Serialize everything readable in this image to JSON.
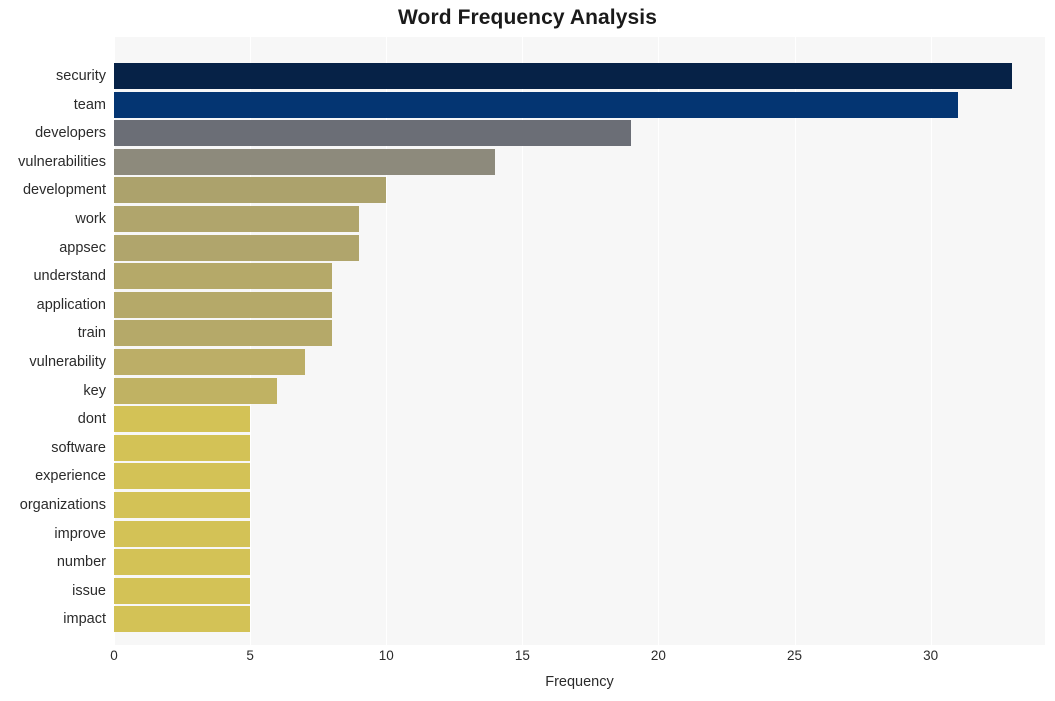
{
  "chart_data": {
    "type": "bar",
    "orientation": "horizontal",
    "title": "Word Frequency Analysis",
    "xlabel": "Frequency",
    "ylabel": "",
    "xlim": [
      0,
      34.2
    ],
    "ylim": null,
    "grid": true,
    "legend": null,
    "xticks": [
      0,
      5,
      10,
      15,
      20,
      25,
      30
    ],
    "xtick_labels": [
      "0",
      "5",
      "10",
      "15",
      "20",
      "25",
      "30"
    ],
    "categories": [
      "security",
      "team",
      "developers",
      "vulnerabilities",
      "development",
      "work",
      "appsec",
      "understand",
      "application",
      "train",
      "vulnerability",
      "key",
      "dont",
      "software",
      "experience",
      "organizations",
      "improve",
      "number",
      "issue",
      "impact"
    ],
    "values": [
      33,
      31,
      19,
      14,
      10,
      9,
      9,
      8,
      8,
      8,
      7,
      6,
      5,
      5,
      5,
      5,
      5,
      5,
      5,
      5
    ],
    "bar_colors": [
      "#062247",
      "#043572",
      "#6b6e76",
      "#8d8a7c",
      "#aca26c",
      "#b0a56c",
      "#b0a56c",
      "#b5a969",
      "#b5a969",
      "#b5a969",
      "#bcae67",
      "#c0b263",
      "#d3c256",
      "#d3c256",
      "#d3c256",
      "#d3c256",
      "#d3c256",
      "#d3c256",
      "#d3c256",
      "#d3c256"
    ],
    "plot_background": "#f7f7f7",
    "gridline_color": "#ffffff"
  }
}
